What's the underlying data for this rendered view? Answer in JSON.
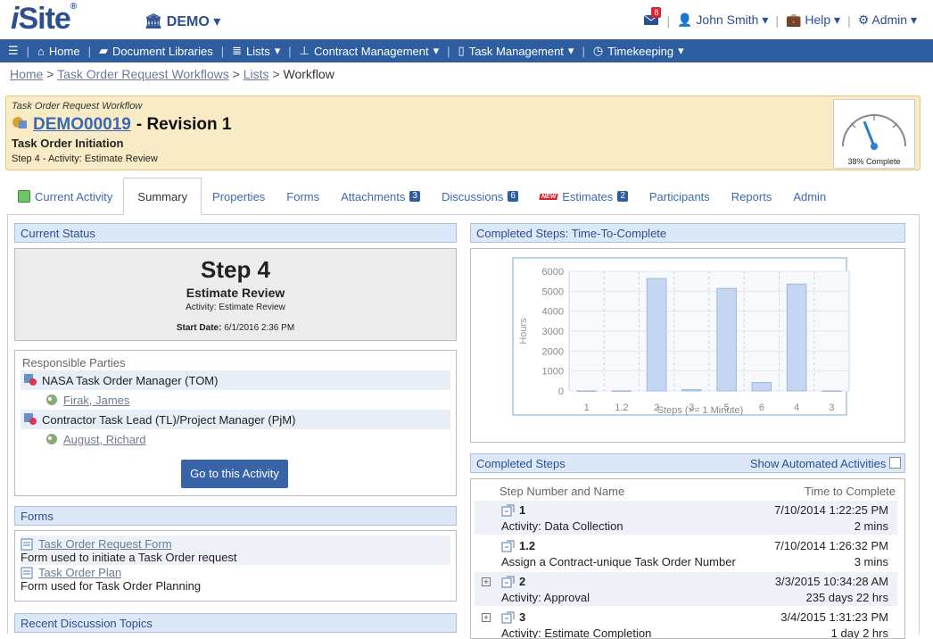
{
  "app": {
    "logo_i": "i",
    "logo_rest": "Site",
    "logo_reg": "®",
    "site": "DEMO"
  },
  "topbar": {
    "mail_count": "8",
    "user": "John Smith",
    "help": "Help",
    "admin": "Admin"
  },
  "nav": [
    {
      "label": "Home",
      "icon": "home-icon",
      "caret": false
    },
    {
      "label": "Document Libraries",
      "icon": "folder-icon",
      "caret": false
    },
    {
      "label": "Lists",
      "icon": "list-icon",
      "caret": true
    },
    {
      "label": "Contract Management",
      "icon": "org-chart-icon",
      "caret": true
    },
    {
      "label": "Task Management",
      "icon": "document-icon",
      "caret": true
    },
    {
      "label": "Timekeeping",
      "icon": "clock-icon",
      "caret": true
    }
  ],
  "breadcrumb": {
    "home": "Home",
    "workflows": "Task Order Request Workflows",
    "lists": "Lists",
    "current": "Workflow",
    "sep": ">"
  },
  "header": {
    "workflow_type": "Task Order Request Workflow",
    "id": "DEMO00019",
    "revision": "- Revision 1",
    "stage": "Task Order Initiation",
    "step": "Step 4 - Activity: Estimate Review",
    "gauge_label": "38% Complete",
    "gauge_fraction": 0.38
  },
  "tabs": [
    {
      "label": "Current Activity",
      "count": null,
      "active": false
    },
    {
      "label": "Summary",
      "count": null,
      "active": true
    },
    {
      "label": "Properties",
      "count": null,
      "active": false
    },
    {
      "label": "Forms",
      "count": null,
      "active": false
    },
    {
      "label": "Attachments",
      "count": "3",
      "active": false
    },
    {
      "label": "Discussions",
      "count": "6",
      "active": false
    },
    {
      "label": "Estimates",
      "count": "2",
      "active": false,
      "new": "NEW"
    },
    {
      "label": "Participants",
      "count": null,
      "active": false
    },
    {
      "label": "Reports",
      "count": null,
      "active": false
    },
    {
      "label": "Admin",
      "count": null,
      "active": false
    }
  ],
  "current_status": {
    "title": "Current Status",
    "step": "Step 4",
    "name": "Estimate Review",
    "activity": "Activity: Estimate Review",
    "start_label": "Start Date:",
    "start_value": "6/1/2016 2:36 PM"
  },
  "responsible": {
    "title": "Responsible Parties",
    "roles": [
      {
        "role": "NASA Task Order Manager (TOM)",
        "person": "Firak, James"
      },
      {
        "role": "Contractor Task Lead (TL)/Project Manager (PjM)",
        "person": "August, Richard"
      }
    ],
    "button": "Go to this Activity"
  },
  "forms": {
    "title": "Forms",
    "items": [
      {
        "name": "Task Order Request Form",
        "desc": "Form used to initiate a Task Order request"
      },
      {
        "name": "Task Order Plan",
        "desc": "Form used for Task Order Planning"
      }
    ]
  },
  "discussions": {
    "title": "Recent Discussion Topics"
  },
  "chart_panel": {
    "title": "Completed Steps: Time-To-Complete"
  },
  "chart_data": {
    "type": "bar",
    "categories": [
      "1",
      "1.2",
      "2",
      "3",
      "5",
      "6",
      "4",
      "3"
    ],
    "values": [
      2,
      3,
      5640,
      60,
      5140,
      420,
      5360,
      2
    ],
    "xlabel": "Steps (>= 1 Minute)",
    "ylabel": "Hours",
    "ylim": [
      0,
      6000
    ],
    "yticks": [
      "0",
      "1000",
      "2000",
      "3000",
      "4000",
      "5000",
      "6000"
    ],
    "grid": true,
    "bar_color": "#c5d6f3"
  },
  "completed_steps": {
    "title": "Completed Steps",
    "toggle": "Show Automated Activities",
    "col_left": "Step Number and Name",
    "col_right": "Time to Complete",
    "rows": [
      {
        "num": "1",
        "name": "Activity: Data Collection",
        "date": "7/10/2014 1:22:25 PM",
        "dur": "2 mins",
        "expand": false
      },
      {
        "num": "1.2",
        "name": "Assign a Contract-unique Task Order Number",
        "date": "7/10/2014 1:26:32 PM",
        "dur": "3 mins",
        "expand": false
      },
      {
        "num": "2",
        "name": "Activity: Approval",
        "date": "3/3/2015 10:34:28 AM",
        "dur": "235 days 22 hrs",
        "expand": true
      },
      {
        "num": "3",
        "name": "Activity: Estimate Completion",
        "date": "3/4/2015 1:31:23 PM",
        "dur": "1 day 2 hrs",
        "expand": true
      }
    ]
  },
  "colors": {
    "brand": "#2e5ea0",
    "header_bg": "#f9ebc6",
    "panel_title": "#dce8f7"
  }
}
